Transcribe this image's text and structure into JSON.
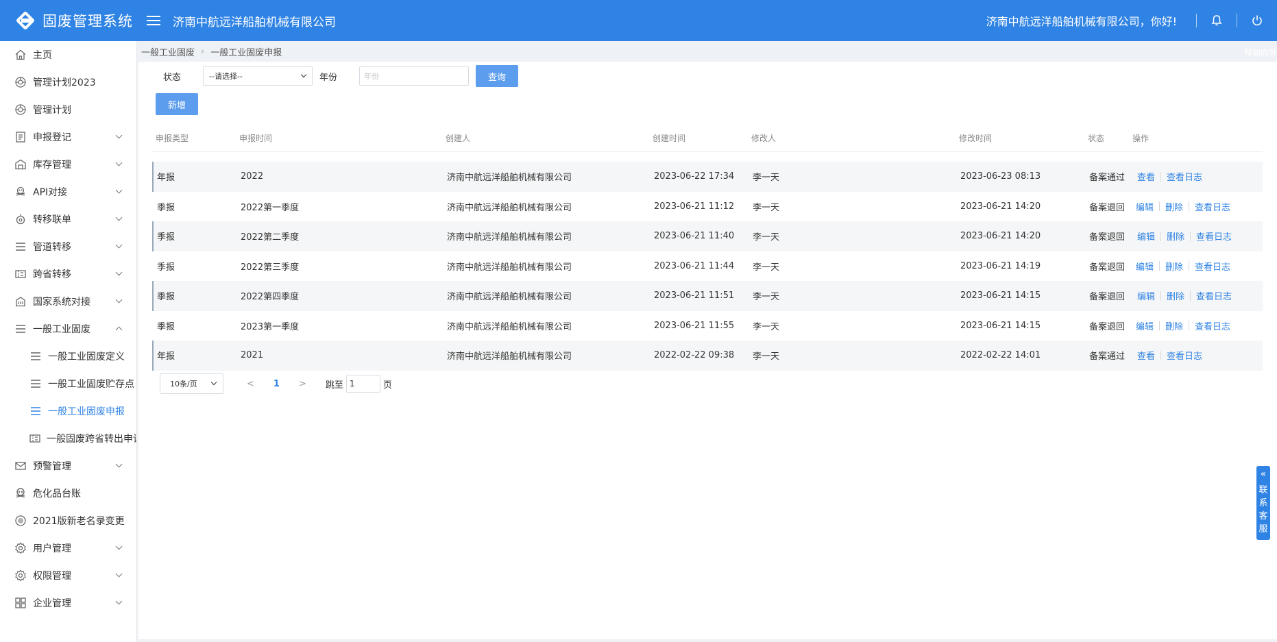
{
  "app": {
    "title": "固废管理系统",
    "company": "济南中航远洋船舶机械有限公司",
    "greeting": "济南中航远洋船舶机械有限公司，你好!"
  },
  "sidebar": {
    "items": [
      {
        "label": "主页",
        "icon": "home-icon"
      },
      {
        "label": "管理计划2023",
        "icon": "plan-icon"
      },
      {
        "label": "管理计划",
        "icon": "plan-icon"
      },
      {
        "label": "申报登记",
        "icon": "form-icon"
      },
      {
        "label": "库存管理",
        "icon": "warehouse-icon"
      },
      {
        "label": "API对接",
        "icon": "api-icon"
      },
      {
        "label": "转移联单",
        "icon": "transfer-icon"
      },
      {
        "label": "管道转移",
        "icon": "list-icon"
      },
      {
        "label": "跨省转移",
        "icon": "ticket-icon"
      },
      {
        "label": "国家系统对接",
        "icon": "building-icon"
      },
      {
        "label": "一般工业固废",
        "icon": "list-icon"
      },
      {
        "label": "一般工业固废定义",
        "icon": "list-icon"
      },
      {
        "label": "一般工业固废贮存点",
        "icon": "list-icon"
      },
      {
        "label": "一般工业固废申报",
        "icon": "list-icon"
      },
      {
        "label": "一般固废跨省转出申请",
        "icon": "ticket-icon"
      },
      {
        "label": "预警管理",
        "icon": "mail-icon"
      },
      {
        "label": "危化品台账",
        "icon": "skull-icon"
      },
      {
        "label": "2021版新老名录变更",
        "icon": "badge-icon"
      },
      {
        "label": "用户管理",
        "icon": "gear-icon"
      },
      {
        "label": "权限管理",
        "icon": "gear-icon"
      },
      {
        "label": "企业管理",
        "icon": "grid-icon"
      }
    ]
  },
  "breadcrumb": [
    "一般工业固废",
    "一般工业固废申报"
  ],
  "help_guide": "帮助向导",
  "filters": {
    "status_label": "状态",
    "status_value": "--请选择--",
    "year_label": "年份",
    "year_placeholder": "年份",
    "query_button": "查询",
    "add_button": "新增"
  },
  "table": {
    "columns": [
      "申报类型",
      "申报时间",
      "创建人",
      "创建时间",
      "修改人",
      "修改时间",
      "状态",
      "操作"
    ],
    "rows": [
      {
        "type": "年报",
        "period": "2022",
        "creator": "济南中航远洋船舶机械有限公司",
        "created": "2023-06-22 17:34",
        "modifier": "李一天",
        "modified": "2023-06-23 08:13",
        "status": "备案通过",
        "ops": [
          "查看",
          "查看日志"
        ]
      },
      {
        "type": "季报",
        "period": "2022第一季度",
        "creator": "济南中航远洋船舶机械有限公司",
        "created": "2023-06-21 11:12",
        "modifier": "李一天",
        "modified": "2023-06-21 14:20",
        "status": "备案退回",
        "ops": [
          "编辑",
          "删除",
          "查看日志"
        ]
      },
      {
        "type": "季报",
        "period": "2022第二季度",
        "creator": "济南中航远洋船舶机械有限公司",
        "created": "2023-06-21 11:40",
        "modifier": "李一天",
        "modified": "2023-06-21 14:20",
        "status": "备案退回",
        "ops": [
          "编辑",
          "删除",
          "查看日志"
        ]
      },
      {
        "type": "季报",
        "period": "2022第三季度",
        "creator": "济南中航远洋船舶机械有限公司",
        "created": "2023-06-21 11:44",
        "modifier": "李一天",
        "modified": "2023-06-21 14:19",
        "status": "备案退回",
        "ops": [
          "编辑",
          "删除",
          "查看日志"
        ]
      },
      {
        "type": "季报",
        "period": "2022第四季度",
        "creator": "济南中航远洋船舶机械有限公司",
        "created": "2023-06-21 11:51",
        "modifier": "李一天",
        "modified": "2023-06-21 14:15",
        "status": "备案退回",
        "ops": [
          "编辑",
          "删除",
          "查看日志"
        ]
      },
      {
        "type": "季报",
        "period": "2023第一季度",
        "creator": "济南中航远洋船舶机械有限公司",
        "created": "2023-06-21 11:55",
        "modifier": "李一天",
        "modified": "2023-06-21 14:15",
        "status": "备案退回",
        "ops": [
          "编辑",
          "删除",
          "查看日志"
        ]
      },
      {
        "type": "年报",
        "period": "2021",
        "creator": "济南中航远洋船舶机械有限公司",
        "created": "2022-02-22 09:38",
        "modifier": "李一天",
        "modified": "2022-02-22 14:01",
        "status": "备案通过",
        "ops": [
          "查看",
          "查看日志"
        ]
      }
    ]
  },
  "pagination": {
    "page_size": "10条/页",
    "prev": "<",
    "current": "1",
    "next": ">",
    "jump_label": "跳至",
    "jump_value": "1",
    "page_suffix": "页"
  },
  "service": {
    "chevrons": "«",
    "label": "联系客服"
  },
  "colors": {
    "primary": "#2f83e4",
    "button": "#5c9ded",
    "background": "#eef1f5"
  }
}
